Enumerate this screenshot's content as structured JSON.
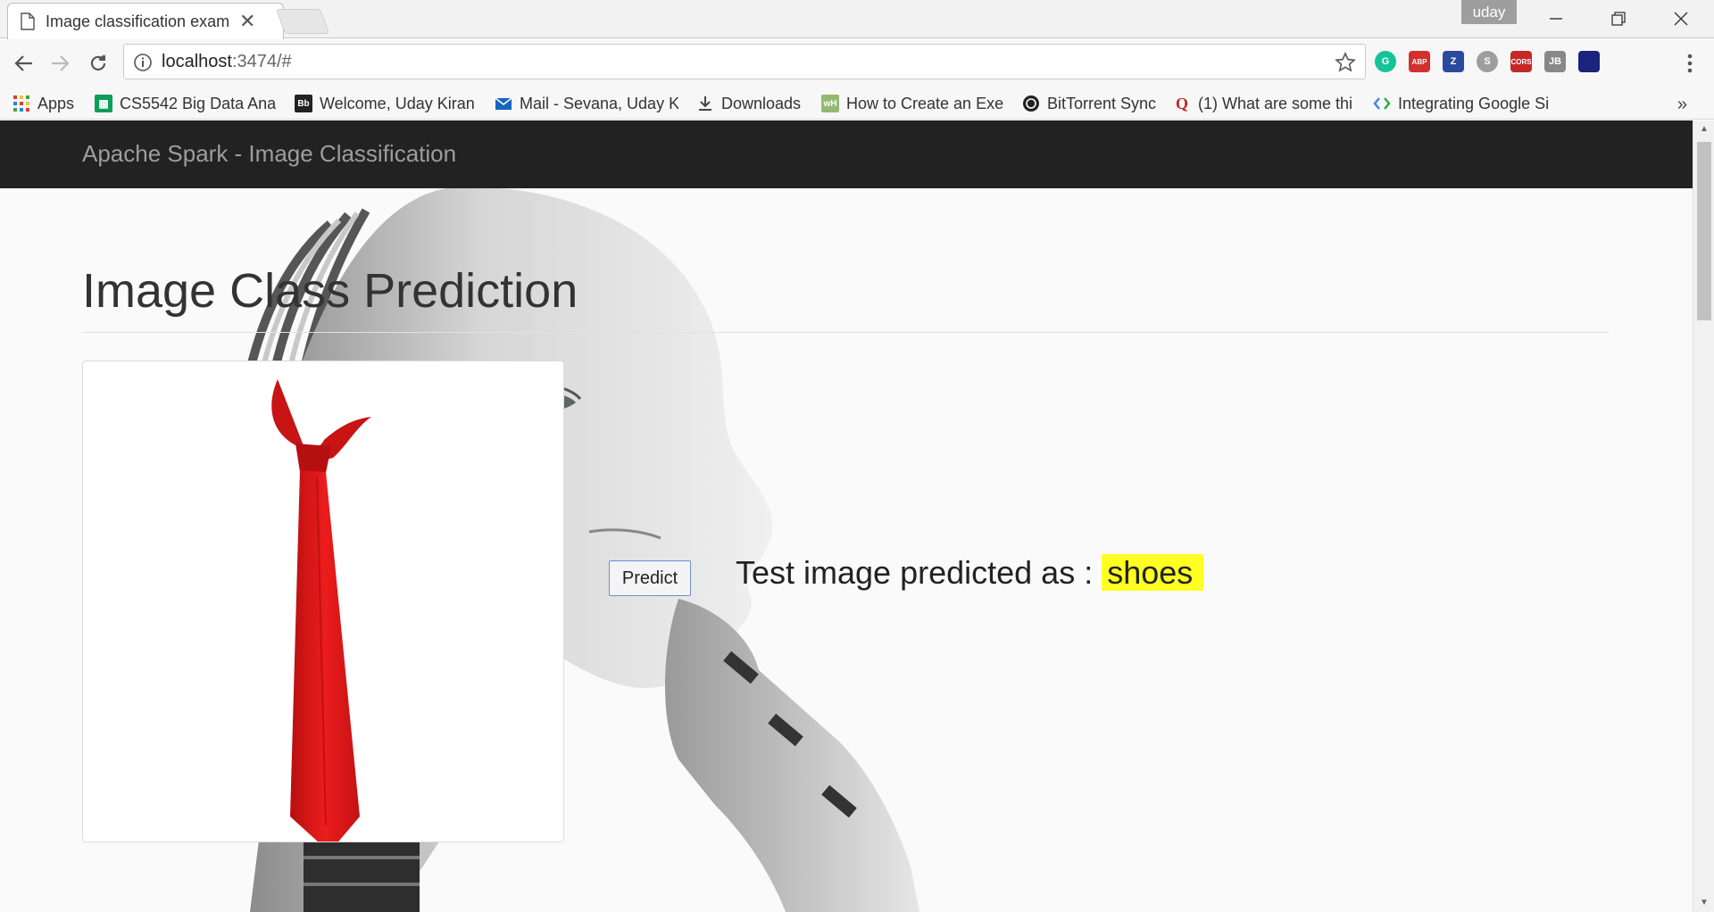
{
  "browser": {
    "tab_title": "Image classification exam",
    "profile_name": "uday",
    "url_host": "localhost",
    "url_rest": ":3474/#",
    "bookmarks": [
      {
        "label": "Apps",
        "icon": "apps-grid-icon"
      },
      {
        "label": "CS5542 Big Data Anal",
        "icon": "sheets-icon"
      },
      {
        "label": "Welcome, Uday Kiran",
        "icon": "blackboard-icon"
      },
      {
        "label": "Mail - Sevana, Uday K",
        "icon": "mail-icon"
      },
      {
        "label": "Downloads",
        "icon": "download-icon"
      },
      {
        "label": "How to Create an Exe",
        "icon": "wikihow-icon"
      },
      {
        "label": "BitTorrent Sync",
        "icon": "bittorrent-icon"
      },
      {
        "label": "(1) What are some thi",
        "icon": "quora-icon"
      },
      {
        "label": "Integrating Google Si",
        "icon": "google-icon"
      }
    ],
    "extensions": [
      {
        "name": "grammarly-icon",
        "color": "#15c39a",
        "text": "G"
      },
      {
        "name": "adblock-plus-icon",
        "color": "#d32f2f",
        "text": "ABP"
      },
      {
        "name": "zotero-icon",
        "color": "#2b4a9b",
        "text": "Z"
      },
      {
        "name": "skype-icon",
        "color": "#9e9e9e",
        "text": "S"
      },
      {
        "name": "cors-icon",
        "color": "#c62828",
        "text": "CORS"
      },
      {
        "name": "jetbrains-icon",
        "color": "#888888",
        "text": "JB"
      },
      {
        "name": "flag-icon",
        "color": "#1a237e",
        "text": ""
      }
    ]
  },
  "page": {
    "brand": "Apache Spark - Image Classification",
    "heading": "Image Class Prediction",
    "predict_label": "Predict",
    "result_prefix": "Test image predicted as :",
    "result_value": "shoes",
    "highlight_color": "#ffff22"
  }
}
